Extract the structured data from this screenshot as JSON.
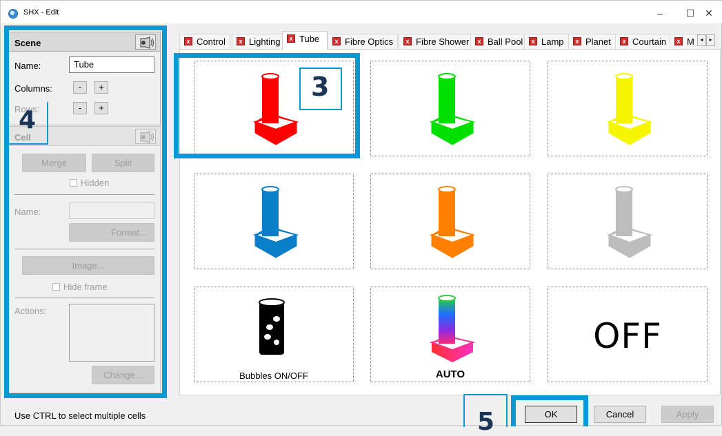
{
  "window": {
    "title": "SHX - Edit",
    "min_glyph": "–",
    "max_glyph": "☐",
    "close_glyph": "✕"
  },
  "scene": {
    "heading": "Scene",
    "name_label": "Name:",
    "name_value": "Tube",
    "columns_label": "Columns:",
    "rows_label": "Rows:",
    "minus": "-",
    "plus": "+"
  },
  "cell_group": {
    "heading": "Cell",
    "merge": "Merge",
    "split": "Split",
    "hidden": "Hidden",
    "name_label": "Name:",
    "format": "Format...",
    "image": "Image...",
    "hide_frame": "Hide frame",
    "actions_label": "Actions:",
    "change": "Change..."
  },
  "tabs": [
    {
      "label": "Control"
    },
    {
      "label": "Lighting"
    },
    {
      "label": "Tube",
      "active": true
    },
    {
      "label": "Fibre Optics"
    },
    {
      "label": "Fibre Shower"
    },
    {
      "label": "Ball Pool"
    },
    {
      "label": "Lamp"
    },
    {
      "label": "Planet"
    },
    {
      "label": "Courtain"
    },
    {
      "label": "M"
    }
  ],
  "tab_scroll": {
    "left": "◂",
    "right": "▸"
  },
  "cells": [
    {
      "icon": "red-tube-icon",
      "color": "#ff0000",
      "caption": ""
    },
    {
      "icon": "green-tube-icon",
      "color": "#00e000",
      "caption": ""
    },
    {
      "icon": "yellow-tube-icon",
      "color": "#f6f600",
      "caption": ""
    },
    {
      "icon": "blue-tube-icon",
      "color": "#0a7ec8",
      "caption": ""
    },
    {
      "icon": "orange-tube-icon",
      "color": "#ff8000",
      "caption": ""
    },
    {
      "icon": "grey-tube-icon",
      "color": "#bdbdbd",
      "caption": ""
    },
    {
      "icon": "bubbles-icon",
      "color": "#000000",
      "caption": "Bubbles ON/OFF"
    },
    {
      "icon": "rainbow-tube-icon",
      "color": "#8a2be2",
      "caption": "AUTO"
    },
    {
      "icon": "off-text-icon",
      "color": "#000000",
      "caption": "",
      "big_text": "OFF"
    }
  ],
  "callouts": {
    "three": "3",
    "four": "4",
    "five": "5"
  },
  "status": "Use CTRL to select multiple cells",
  "buttons": {
    "ok": "OK",
    "cancel": "Cancel",
    "apply": "Apply"
  },
  "colors": {
    "accent": "#0a9ad3",
    "tab_close": "#d32f2f"
  }
}
